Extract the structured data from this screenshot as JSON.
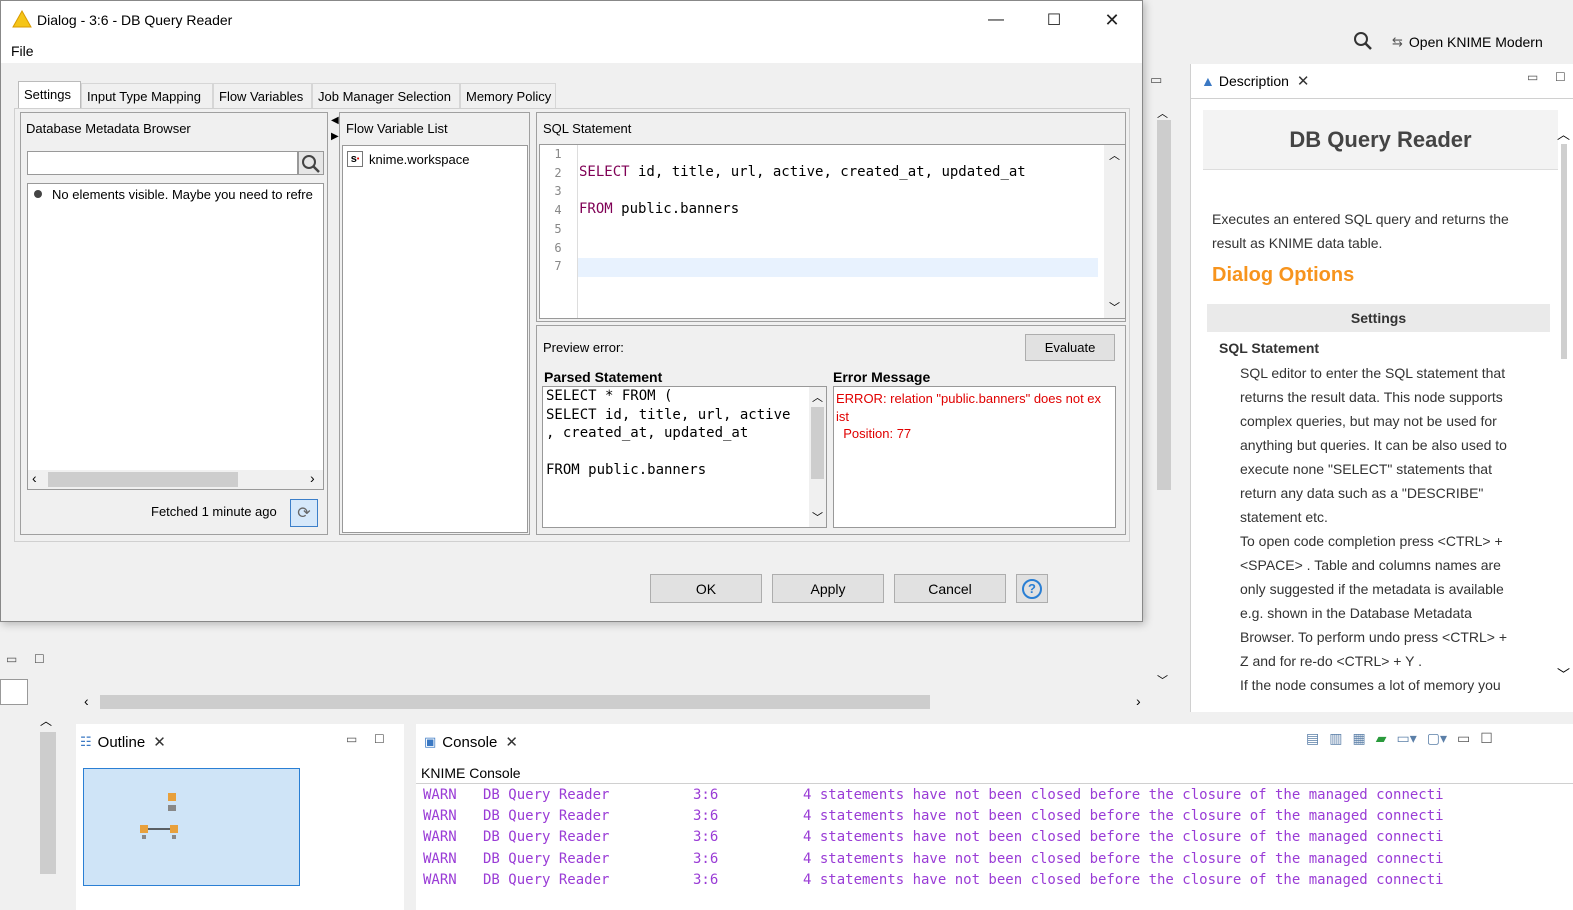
{
  "dialog": {
    "title": "Dialog - 3:6 - DB Query Reader",
    "menu": [
      "File"
    ],
    "tabs": [
      "Settings",
      "Input Type Mapping",
      "Flow Variables",
      "Job Manager Selection",
      "Memory Policy"
    ],
    "metadata_browser": {
      "title": "Database Metadata Browser",
      "search_value": "",
      "empty_message": "No elements visible. Maybe you need to refre",
      "fetched": "Fetched 1 minute ago"
    },
    "flow_variables": {
      "title": "Flow Variable List",
      "items": [
        "knime.workspace"
      ]
    },
    "sql": {
      "title": "SQL Statement",
      "line_numbers": [
        "1",
        "2",
        "3",
        "4",
        "5",
        "6",
        "7"
      ],
      "line2_kw": "SELECT",
      "line2_rest": " id, title, url, active, created_at, updated_at",
      "line4_kw": "FROM",
      "line4_rest": " public.banners"
    },
    "preview": {
      "label": "Preview error:",
      "evaluate": "Evaluate",
      "parsed_title": "Parsed Statement",
      "parsed_lines": [
        "SELECT * FROM (",
        "SELECT id, title, url, active",
        ", created_at, updated_at",
        "",
        "FROM public.banners"
      ],
      "error_title": "Error Message",
      "error_line1": "ERROR: relation \"public.banners\" does not ex",
      "error_line2": "ist",
      "error_line3": "  Position: 77"
    },
    "buttons": {
      "ok": "OK",
      "apply": "Apply",
      "cancel": "Cancel"
    }
  },
  "app": {
    "open_modern": "Open KNIME Modern",
    "description": {
      "tab": "Description",
      "node_title": "DB Query Reader",
      "summary_1": "Executes an entered SQL query and returns the",
      "summary_2": "result as KNIME data table.",
      "dialog_options": "Dialog Options",
      "section": "Settings",
      "option_title": "SQL Statement",
      "option_lines": [
        "SQL editor to enter the SQL statement that",
        "returns the result data. This node supports",
        "complex queries, but may not be used for",
        "anything but queries. It can be also used to",
        "execute none \"SELECT\" statements that",
        "return any data such as a \"DESCRIBE\"",
        "statement etc.",
        "To open code completion press <CTRL> +",
        "<SPACE> . Table and columns names are",
        "only suggested if the metadata is available",
        "e.g. shown in the Database Metadata",
        "Browser. To perform undo press <CTRL> +",
        "Z and for re-do <CTRL> + Y .",
        "If the node consumes a lot of memory you"
      ]
    },
    "outline_tab": "Outline",
    "console_tab": "Console",
    "console_title": "KNIME Console",
    "console_rows": [
      {
        "level": "WARN",
        "node": "DB Query Reader",
        "id": "3:6",
        "msg": "4 statements have not been closed before the closure of the managed connecti"
      },
      {
        "level": "WARN",
        "node": "DB Query Reader",
        "id": "3:6",
        "msg": "4 statements have not been closed before the closure of the managed connecti"
      },
      {
        "level": "WARN",
        "node": "DB Query Reader",
        "id": "3:6",
        "msg": "4 statements have not been closed before the closure of the managed connecti"
      },
      {
        "level": "WARN",
        "node": "DB Query Reader",
        "id": "3:6",
        "msg": "4 statements have not been closed before the closure of the managed connecti"
      },
      {
        "level": "WARN",
        "node": "DB Query Reader",
        "id": "3:6",
        "msg": "4 statements have not been closed before the closure of the managed connecti"
      }
    ]
  },
  "colors": {
    "accent_orange": "#f7941d",
    "error_red": "#e00000",
    "console_purple": "#9a3cd6",
    "keyword": "#7f0055"
  },
  "icons": [
    "warning-icon",
    "search-icon",
    "refresh-icon",
    "help-icon",
    "close-icon",
    "minimize-icon",
    "maximize-icon"
  ]
}
